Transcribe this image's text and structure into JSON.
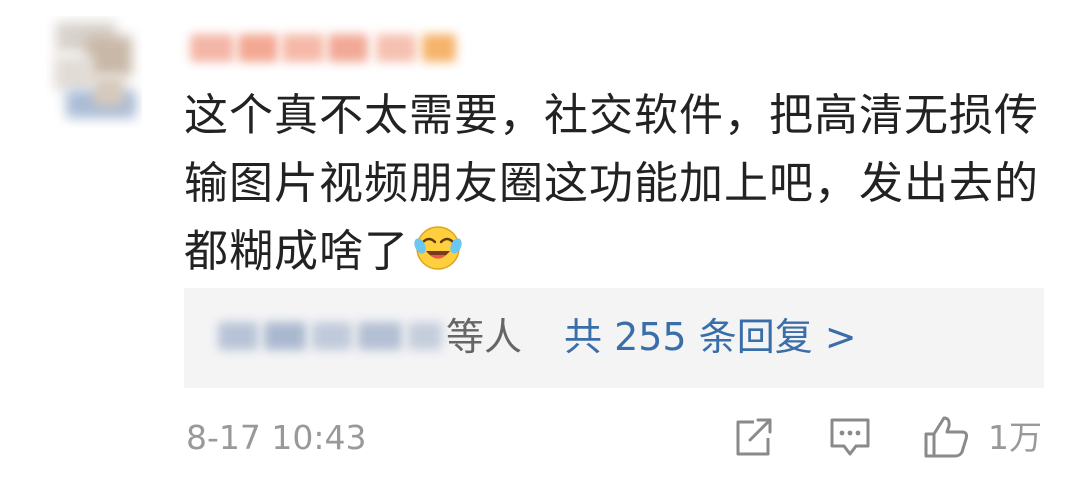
{
  "comment": {
    "text": "这个真不太需要，社交软件，把高清无损传输图片视频朋友圈这功能加上吧，发出去的都糊成啥了",
    "emoji": "laughing-crying-emoji",
    "timestamp": "8-17 10:43",
    "like_count": "1万"
  },
  "replies": {
    "others_suffix": "等人",
    "total_label": "共 255 条回复 >"
  },
  "icons": {
    "share": "share-icon",
    "reply": "comment-icon",
    "like": "thumbs-up-icon"
  },
  "colors": {
    "link": "#3a6ea8",
    "muted": "#999999",
    "text": "#222222",
    "reply_bg": "#f4f4f5"
  }
}
